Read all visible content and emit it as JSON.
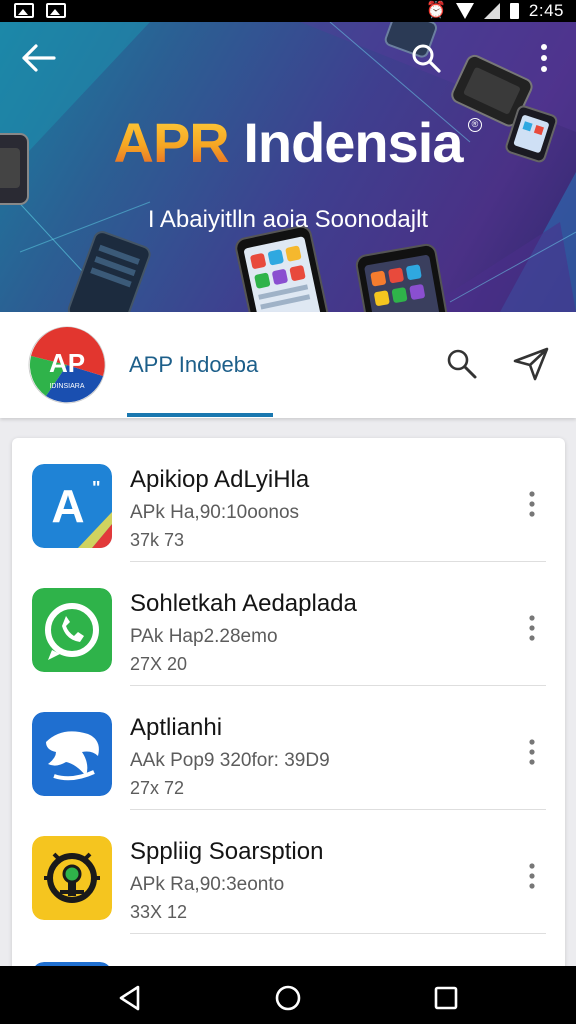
{
  "status_bar": {
    "time": "2:45",
    "icons": [
      "image-icon",
      "image-icon",
      "alarm-icon",
      "wifi-icon",
      "signal-icon",
      "battery-icon"
    ]
  },
  "banner": {
    "title_highlight": "APR",
    "title_rest": "Indensia",
    "registered_mark": "®",
    "subtitle": "I Abaiyitlln aoia Soonodajlt"
  },
  "header": {
    "app_name": "APP Indoeba",
    "logo_text": "IDINSIARA"
  },
  "apps": [
    {
      "name": "Apikiop AdLyiHla",
      "meta": "APk Ha,90:10oonos",
      "size": "37k 73",
      "icon": "a-letter-icon",
      "icon_color": "#1f83d6"
    },
    {
      "name": "Sohletkah Aedaplada",
      "meta": "PAk Hap2.28emo",
      "size": "27X 20",
      "icon": "chat-bubble-icon",
      "icon_color": "#2fb34a"
    },
    {
      "name": "Aptlianhi",
      "meta": "AAk Pop9 320for: 39D9",
      "size": "27x 72",
      "icon": "dolphin-icon",
      "icon_color": "#1f6fd0"
    },
    {
      "name": "Sppliig Soarsption",
      "meta": "APk Ra,90:3eonto",
      "size": "33X 12",
      "icon": "badge-icon",
      "icon_color": "#f5c51f"
    }
  ],
  "colors": {
    "accent": "#1a78b0",
    "nav_bar": "#000000"
  }
}
